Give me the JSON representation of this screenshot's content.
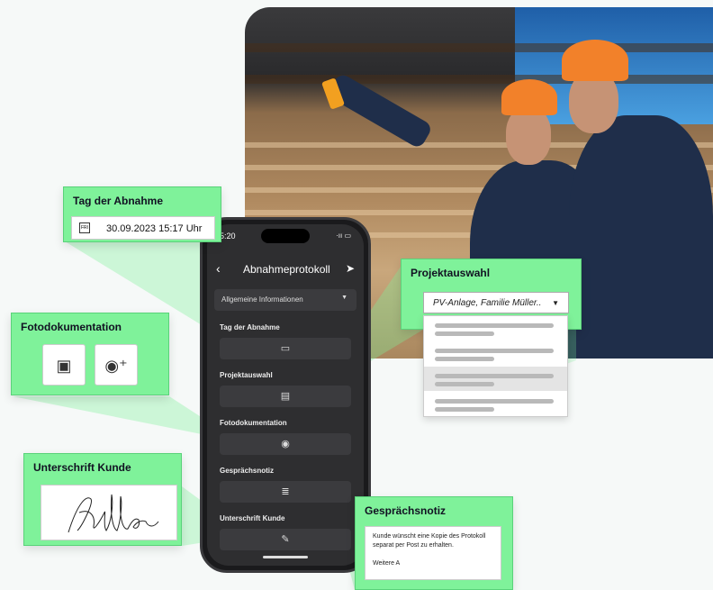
{
  "phone": {
    "time": "5:20",
    "battery": "·ıı ▭",
    "title": "Abnahmeprotokoll",
    "dropdown": "Allgemeine Informationen",
    "sections": [
      {
        "label": "Tag der Abnahme"
      },
      {
        "label": "Projektauswahl"
      },
      {
        "label": "Fotodokumentation"
      },
      {
        "label": "Gesprächsnotiz"
      },
      {
        "label": "Unterschrift Kunde"
      }
    ]
  },
  "tag_card": {
    "title": "Tag der Abnahme",
    "icon_label": "FRI",
    "date": "30.09.2023  15:17 Uhr"
  },
  "foto_card": {
    "title": "Fotodokumentation"
  },
  "unterschrift_card": {
    "title": "Unterschrift Kunde"
  },
  "projekt_card": {
    "title": "Projektauswahl",
    "selected": "PV-Anlage, Familie Müller.."
  },
  "notiz_card": {
    "title": "Gesprächsnotiz",
    "text_line1": "Kunde wünscht eine Kopie des Protokoll",
    "text_line2": "separat per Post zu erhalten.",
    "text_line3": "Weitere A"
  },
  "colors": {
    "accent": "#7ff29a",
    "phone_bg": "#2e2e30"
  }
}
